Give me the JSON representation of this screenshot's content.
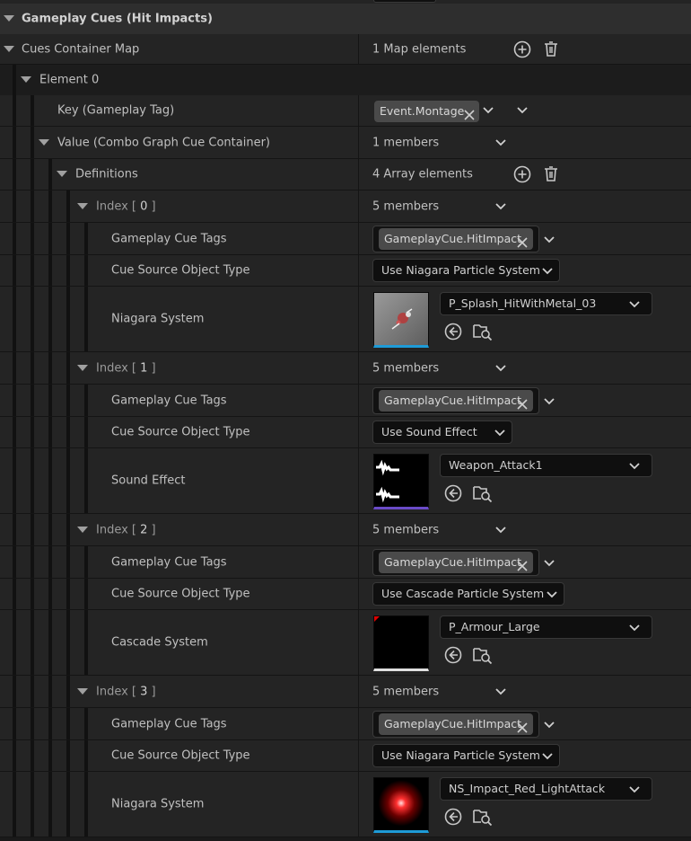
{
  "section": {
    "title": "Gameplay Cues (Hit Impacts)"
  },
  "map": {
    "label": "Cues Container Map",
    "value": "1 Map elements"
  },
  "element0": {
    "label": "Element 0"
  },
  "key": {
    "label": "Key (Gameplay Tag)",
    "tag": "Event.Montage"
  },
  "value_container": {
    "label": "Value (Combo Graph Cue Container)",
    "value": "1 members"
  },
  "definitions": {
    "label": "Definitions",
    "value": "4 Array elements"
  },
  "indices": [
    {
      "label_pre": "Index [ ",
      "num": "0",
      "label_post": " ]",
      "members": "5 members",
      "tags_label": "Gameplay Cue Tags",
      "tag": "GameplayCue.HitImpact",
      "source_label": "Cue Source Object Type",
      "source_value": "Use Niagara Particle System",
      "asset_label": "Niagara System",
      "asset_value": "P_Splash_HitWithMetal_03"
    },
    {
      "label_pre": "Index [ ",
      "num": "1",
      "label_post": " ]",
      "members": "5 members",
      "tags_label": "Gameplay Cue Tags",
      "tag": "GameplayCue.HitImpact",
      "source_label": "Cue Source Object Type",
      "source_value": "Use Sound Effect",
      "asset_label": "Sound Effect",
      "asset_value": "Weapon_Attack1"
    },
    {
      "label_pre": "Index [ ",
      "num": "2",
      "label_post": " ]",
      "members": "5 members",
      "tags_label": "Gameplay Cue Tags",
      "tag": "GameplayCue.HitImpact",
      "source_label": "Cue Source Object Type",
      "source_value": "Use Cascade Particle System",
      "asset_label": "Cascade System",
      "asset_value": "P_Armour_Large"
    },
    {
      "label_pre": "Index [ ",
      "num": "3",
      "label_post": " ]",
      "members": "5 members",
      "tags_label": "Gameplay Cue Tags",
      "tag": "GameplayCue.HitImpact",
      "source_label": "Cue Source Object Type",
      "source_value": "Use Niagara Particle System",
      "asset_label": "Niagara System",
      "asset_value": "NS_Impact_Red_LightAttack"
    }
  ],
  "icons": {
    "expand": "triangle-down-icon",
    "add": "plus-circle-icon",
    "delete": "trash-icon",
    "clear": "x-icon",
    "dropdown": "chevron-down-icon",
    "use_selected": "arrow-left-circle-icon",
    "browse": "folder-search-icon"
  },
  "colors": {
    "niagara_underline": "#1e9bd7",
    "sound_underline": "#6a4bc8",
    "cascade_underline": "#e0e0e0"
  }
}
